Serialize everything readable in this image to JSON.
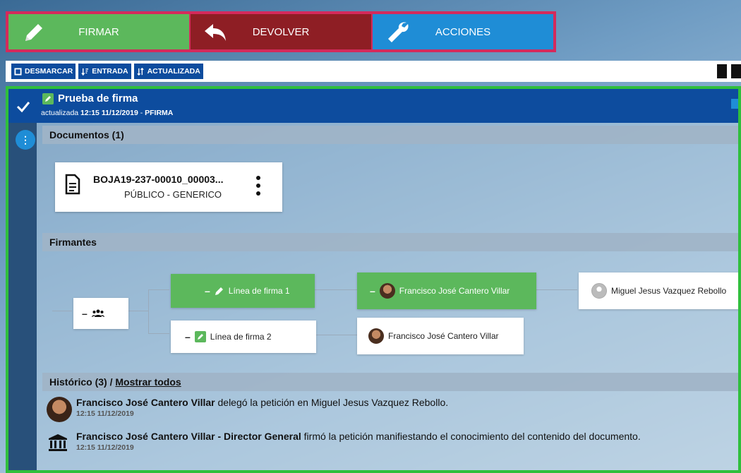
{
  "actions": {
    "firmar": "FIRMAR",
    "devolver": "DEVOLVER",
    "acciones": "ACCIONES"
  },
  "toolbar": {
    "desmarcar": "DESMARCAR",
    "entrada": "ENTRADA",
    "actualizada": "ACTUALIZADA"
  },
  "request": {
    "title": "Prueba de firma",
    "updated_label": "actualizada",
    "updated_at": "12:15 11/12/2019",
    "separator": "-",
    "app": "PFIRMA"
  },
  "documents": {
    "header": "Documentos (1)",
    "items": [
      {
        "name": "BOJA19-237-00010_00003...",
        "type": "PÚBLICO - GENERICO"
      }
    ]
  },
  "signers": {
    "header": "Firmantes",
    "root_dash": "–",
    "lines": [
      {
        "label": "Línea de firma 1",
        "dash": "–"
      },
      {
        "label": "Línea de firma 2",
        "dash": "–"
      }
    ],
    "people": [
      {
        "name": "Francisco José Cantero Villar",
        "dash": "–"
      },
      {
        "name": "Miguel Jesus Vazquez Rebollo"
      },
      {
        "name": "Francisco José Cantero Villar"
      }
    ]
  },
  "history": {
    "header_prefix": "Histórico (3) /",
    "show_all": "Mostrar todos",
    "items": [
      {
        "actor": "Francisco José Cantero Villar",
        "action": " delegó la petición en Miguel Jesus Vazquez Rebollo.",
        "time": "12:15 11/12/2019"
      },
      {
        "actor": "Francisco José Cantero Villar - Director General",
        "action": " firmó la petición manifiestando el conocimiento del contenido del documento.",
        "time": "12:15 11/12/2019"
      }
    ]
  },
  "colors": {
    "firmar": "#5cb85c",
    "devolver": "#8e1e24",
    "acciones": "#1f8dd6",
    "header": "#0d4c9e",
    "card_border": "#2fbf3c",
    "topbar_border": "#d42a5c"
  }
}
